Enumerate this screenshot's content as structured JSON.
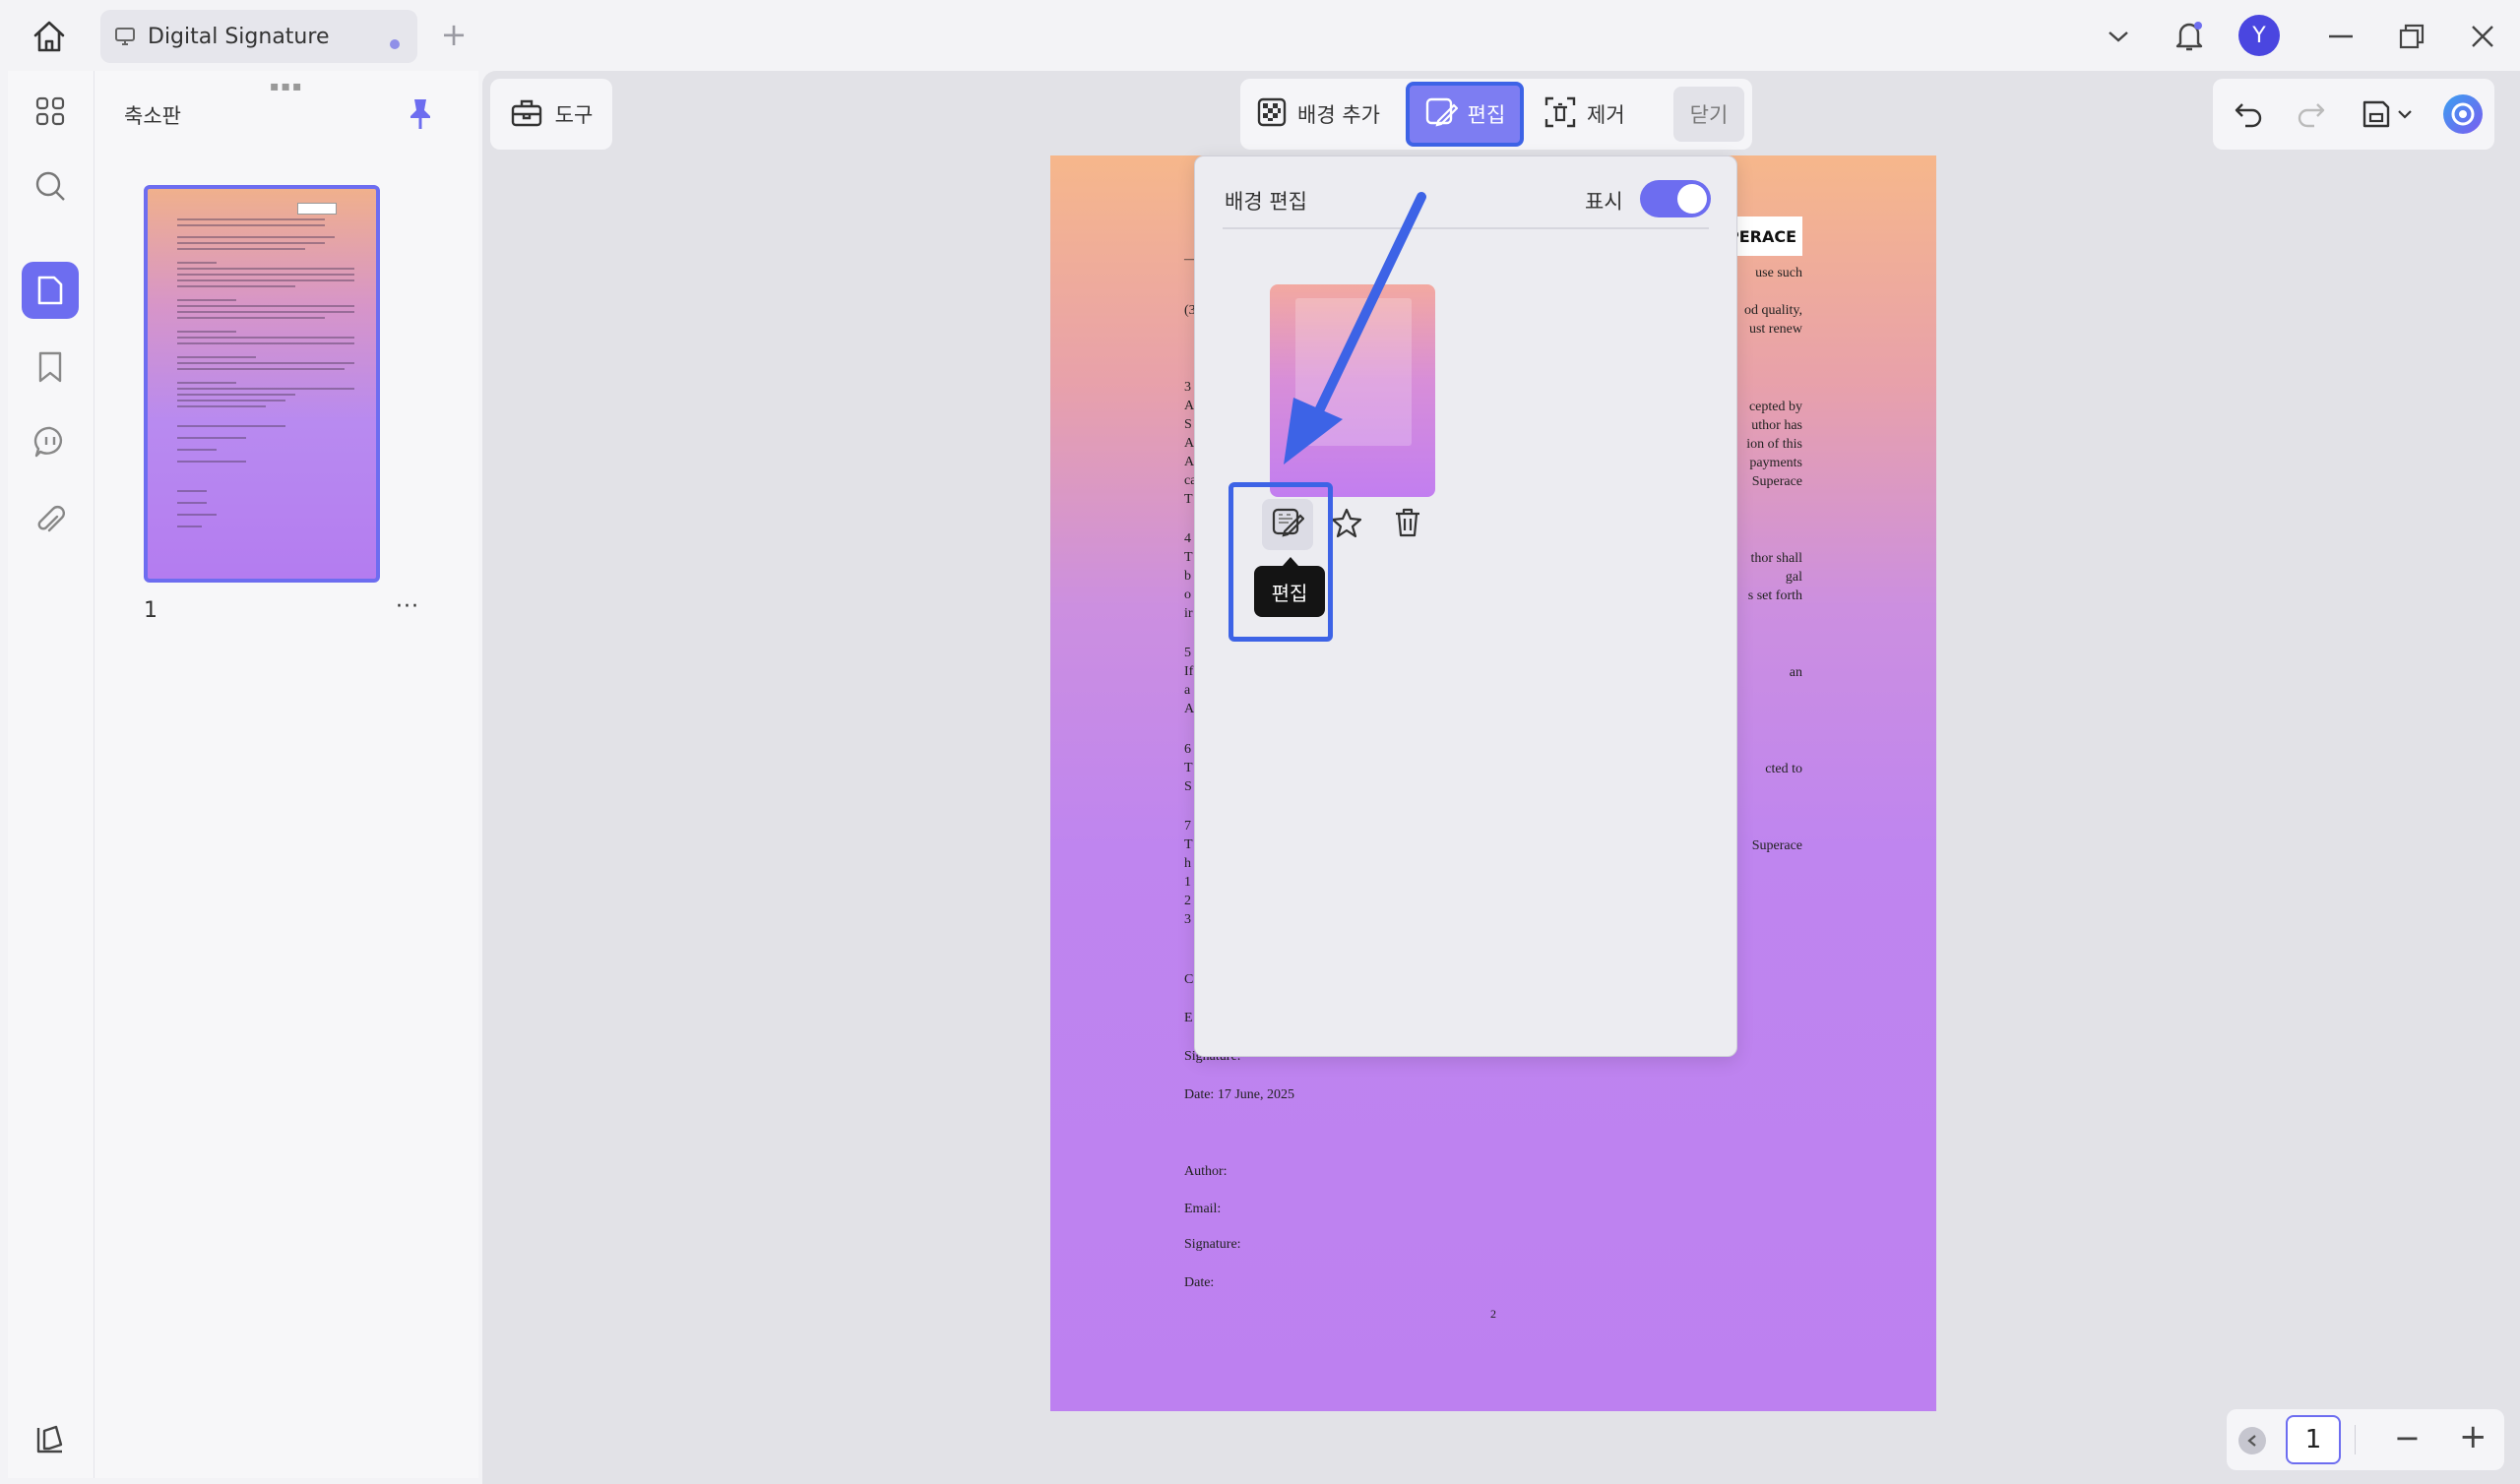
{
  "tab": {
    "title": "Digital Signature"
  },
  "thumbnail_panel": {
    "title": "축소판",
    "page_number": "1",
    "more": "···"
  },
  "toolbar": {
    "tools_label": "도구"
  },
  "background_toolbar": {
    "add_label": "배경 추가",
    "edit_label": "편집",
    "remove_label": "제거",
    "close_label": "닫기"
  },
  "background_panel": {
    "title": "배경 편집",
    "show_label": "표시",
    "show_enabled": true,
    "tooltip": "편집"
  },
  "user": {
    "avatar_initial": "Y"
  },
  "page_nav": {
    "current_page": "1"
  },
  "document": {
    "logo": "PERACE",
    "lines_right": [
      "use  such",
      "od quality,",
      "ust  renew",
      "cepted  by",
      "uthor  has",
      "ion  of  this",
      "payments",
      "Superace",
      "thor  shall",
      "gal",
      "s set forth",
      "an",
      "cted to",
      "Superace"
    ],
    "lines_left": [
      "—",
      "(3",
      "3",
      "A",
      "S",
      "A",
      "A",
      "ca",
      "T",
      "4",
      "T",
      "b",
      "o",
      "ir",
      "5",
      "If",
      "a",
      "A",
      "6",
      "T",
      "S",
      "7",
      "T",
      "h",
      "1",
      "2",
      "3",
      "C",
      "E"
    ],
    "signature_block_1": {
      "signature": "Signature:",
      "date": "Date: 17 June, 2025"
    },
    "signature_block_2": {
      "author": "Author:",
      "email": "Email:",
      "signature": "Signature:",
      "date": "Date:"
    },
    "page_number": "2"
  },
  "colors": {
    "accent": "#6d6df0",
    "highlight": "#3d63e6"
  }
}
